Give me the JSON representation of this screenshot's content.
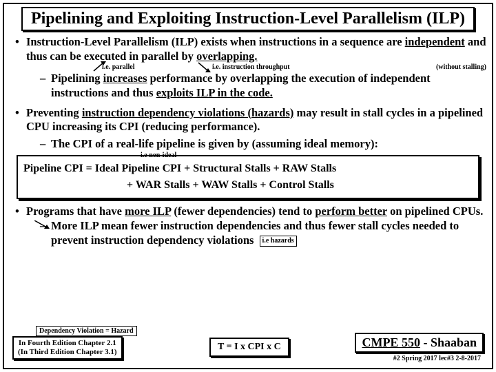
{
  "title": "Pipelining and Exploiting Instruction-Level Parallelism (ILP)",
  "bullets": {
    "b1": {
      "text_a": "Instruction-Level Parallelism  (ILP) exists when instructions in a sequence are ",
      "u1": "independent",
      "text_b": " and thus can be executed in parallel by ",
      "u2": "overlapping.",
      "ann_parallel": "i.e. parallel",
      "ann_throughput": "i.e. instruction throughput",
      "ann_stalling": "(without stalling)",
      "sub1_a": "Pipelining ",
      "sub1_u": "increases",
      "sub1_b": " performance by overlapping the execution of independent instructions and thus ",
      "sub1_u2": "exploits ILP in the code."
    },
    "b2": {
      "text_a": "Preventing ",
      "u1": "instruction dependency violations  (hazards)",
      "text_b": " may result in stall cycles in a pipelined CPU increasing its CPI (reducing performance).",
      "sub1": "The CPI of a real-life pipeline is given by (assuming ideal memory):",
      "ann_nonideal": "i.e non-ideal"
    },
    "formula": {
      "line1": "Pipeline  CPI  =  Ideal Pipeline CPI +  Structural Stalls  +  RAW Stalls",
      "line2": "+  WAR Stalls  +  WAW Stalls  +  Control Stalls"
    },
    "b3": {
      "text_a": "Programs that have ",
      "u1": "more ILP",
      "text_b": " (fewer dependencies) tend to ",
      "u2": "perform better",
      "text_c": " on pipelined CPUs.",
      "sub1": "More ILP mean fewer instruction dependencies and thus fewer stall cycles needed to prevent instruction dependency violations",
      "ann_hazards": "i.e hazards",
      "dep_box": "Dependency Violation = Hazard"
    }
  },
  "footer": {
    "left_l1": "In Fourth Edition Chapter 2.1",
    "left_l2": "(In Third Edition Chapter 3.1)",
    "mid": "T = I x CPI x C",
    "right": "CMPE 550 - Shaaban",
    "sub": "#2  Spring 2017   lec#3  2-8-2017"
  }
}
